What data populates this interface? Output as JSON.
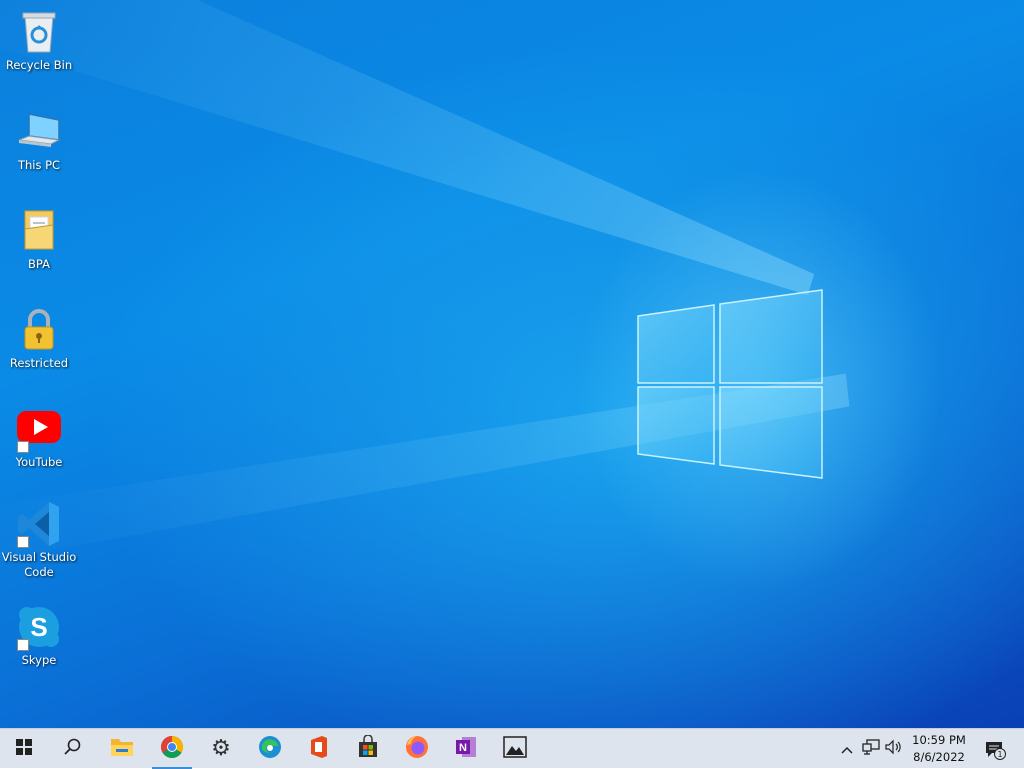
{
  "desktop": {
    "icons": [
      {
        "label": "Recycle Bin",
        "icon": "recycle-bin-icon"
      },
      {
        "label": "This PC",
        "icon": "computer-icon"
      },
      {
        "label": "BPA",
        "icon": "folder-icon"
      },
      {
        "label": "Restricted",
        "icon": "lock-icon"
      },
      {
        "label": "YouTube",
        "icon": "youtube-icon"
      },
      {
        "label": "Visual Studio Code",
        "icon": "vscode-icon"
      },
      {
        "label": "Skype",
        "icon": "skype-icon"
      }
    ]
  },
  "taskbar": {
    "pinned": [
      "start-icon",
      "search-icon",
      "file-explorer-icon",
      "chrome-icon",
      "settings-icon",
      "edge-icon",
      "office-icon",
      "store-icon",
      "firefox-icon",
      "onenote-icon",
      "photos-icon"
    ],
    "tray": {
      "time": "10:59 PM",
      "date": "8/6/2022",
      "notification_count": "1"
    }
  },
  "colors": {
    "wallpaper_primary": "#0a8be6",
    "wallpaper_deep": "#0a3fb5",
    "taskbar_bg": "#dde4ed",
    "accent": "#3a8fd8"
  }
}
